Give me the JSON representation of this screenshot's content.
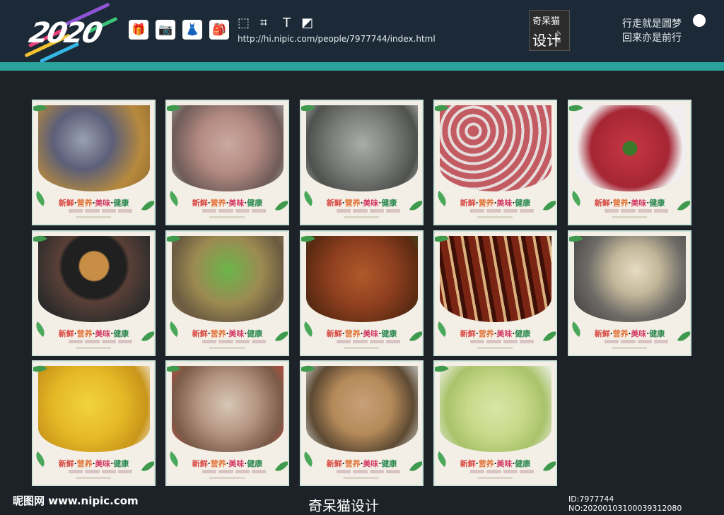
{
  "header": {
    "logo_text": "2020",
    "url": "http://hi.nipic.com/people/7977744/index.html",
    "brand": {
      "line1": "奇呆猫",
      "line2": "设计",
      "line3": "小站"
    },
    "slogan": {
      "line1": "行走就是圆梦",
      "line2": "回来亦是前行"
    },
    "toolbar_icons": [
      "gift-icon",
      "camera-icon",
      "dress-icon",
      "backpack-icon",
      "selection-icon",
      "crop-icon",
      "text-icon",
      "fill-icon"
    ]
  },
  "card_slogan": {
    "w1": "新鲜",
    "w2": "营养",
    "w3": "美味",
    "w4": "健康",
    "sep": "·"
  },
  "cards": [
    {
      "id": "pigeon-soup",
      "photo": "food-photo-1"
    },
    {
      "id": "pork-trotter-pot",
      "photo": "food-photo-2"
    },
    {
      "id": "tripe-soup",
      "photo": "food-photo-3"
    },
    {
      "id": "meatballs",
      "photo": "food-photo-4"
    },
    {
      "id": "beef-slices",
      "photo": "food-photo-5"
    },
    {
      "id": "hotpot",
      "photo": "food-photo-6"
    },
    {
      "id": "stir-fry-greens",
      "photo": "food-photo-7"
    },
    {
      "id": "spicy-liver",
      "photo": "food-photo-8"
    },
    {
      "id": "braised-pork",
      "photo": "food-photo-9"
    },
    {
      "id": "chicken-soup",
      "photo": "food-photo-10"
    },
    {
      "id": "white-cut-chicken",
      "photo": "food-photo-11"
    },
    {
      "id": "lamb-stew",
      "photo": "food-photo-12"
    },
    {
      "id": "steamed-fish",
      "photo": "food-photo-13"
    },
    {
      "id": "fried-rice",
      "photo": "food-photo-14"
    }
  ],
  "colors": {
    "background": "#1c2227",
    "header": "#1b2a36",
    "teal_band": "#2aa39a",
    "card_bg": "#f4efe6",
    "card_border": "#cfe6dc"
  },
  "watermark": {
    "left": "昵图网 www.nipic.com",
    "right": "ID:7977744 NO:20200103100039312080",
    "mid": "奇呆猫设计"
  }
}
